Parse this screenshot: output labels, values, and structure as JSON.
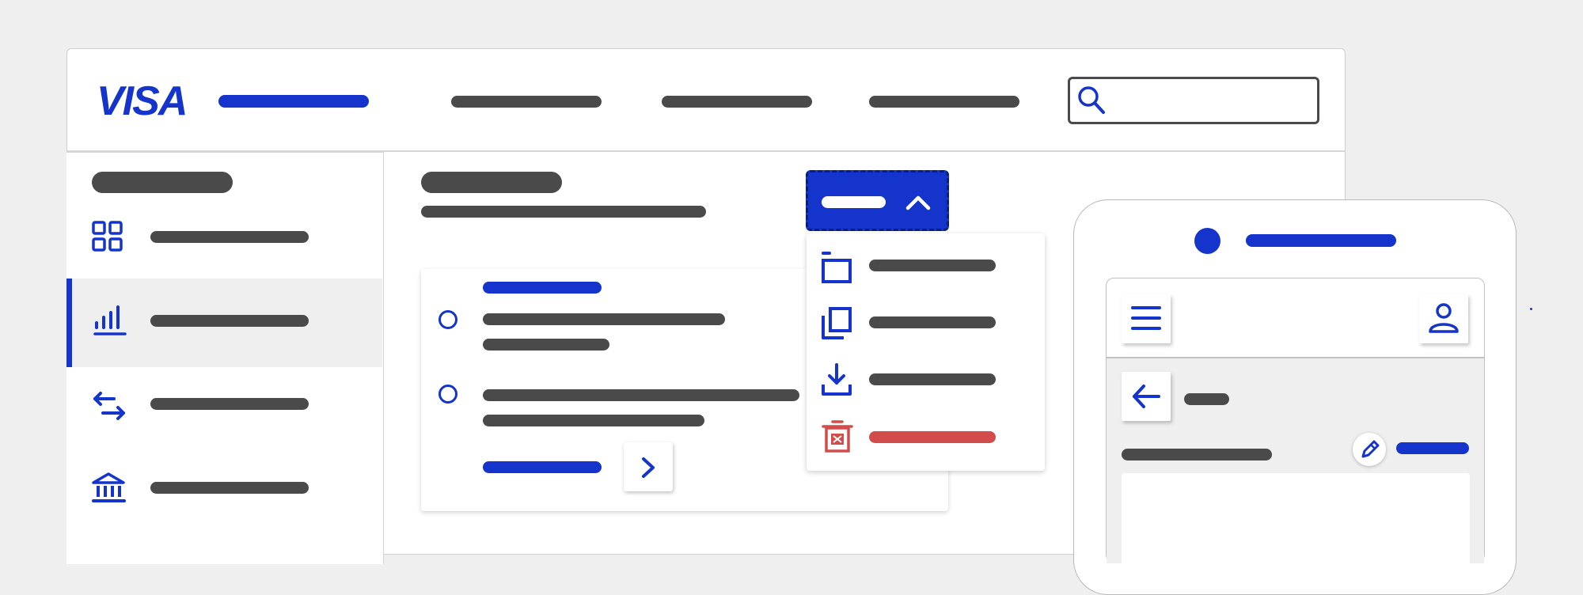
{
  "header": {
    "logo_text": "VISA",
    "brand_color": "#1434cb",
    "nav_items": 3,
    "search_icon": "search-icon"
  },
  "sidebar": {
    "items": [
      {
        "icon": "dashboard-grid-icon",
        "active": false
      },
      {
        "icon": "bar-chart-icon",
        "active": true
      },
      {
        "icon": "transfer-arrows-icon",
        "active": false
      },
      {
        "icon": "bank-icon",
        "active": false
      }
    ]
  },
  "dropdown": {
    "icon": "chevron-up-icon",
    "menu_items": [
      {
        "icon": "archive-icon"
      },
      {
        "icon": "copy-icon"
      },
      {
        "icon": "download-icon"
      },
      {
        "icon": "delete-icon",
        "danger": true
      }
    ]
  },
  "card": {
    "options": [
      {
        "icon": "radio-unselected"
      },
      {
        "icon": "radio-unselected"
      }
    ],
    "next_icon": "chevron-right-icon"
  },
  "phone": {
    "icons": [
      "menu-icon",
      "user-icon",
      "back-arrow-icon",
      "pencil-icon"
    ]
  },
  "colors": {
    "accent": "#1434cb",
    "text_placeholder": "#4a4a4a",
    "danger": "#d24c4c",
    "background": "#efefef"
  }
}
